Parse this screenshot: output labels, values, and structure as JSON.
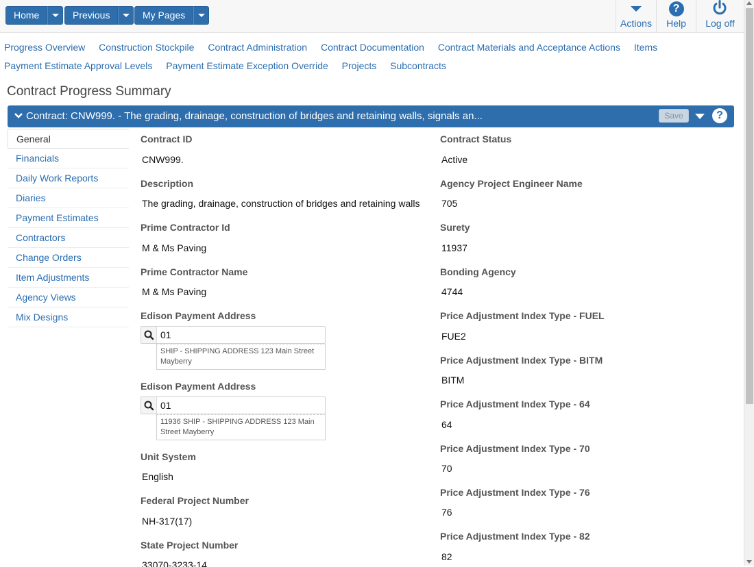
{
  "topbar": {
    "home": "Home",
    "previous": "Previous",
    "my_pages": "My Pages",
    "actions": "Actions",
    "help": "Help",
    "logoff": "Log off"
  },
  "links_row1": [
    "Progress Overview",
    "Construction Stockpile",
    "Contract Administration",
    "Contract Documentation",
    "Contract Materials and Acceptance Actions",
    "Items"
  ],
  "links_row2": [
    "Payment Estimate Approval Levels",
    "Payment Estimate Exception Override",
    "Projects",
    "Subcontracts"
  ],
  "page_title": "Contract Progress Summary",
  "contract_bar": {
    "title": "Contract: CNW999. - The grading, drainage, construction of bridges and retaining walls, signals an...",
    "save": "Save"
  },
  "tabs": [
    "General",
    "Financials",
    "Daily Work Reports",
    "Diaries",
    "Payment Estimates",
    "Contractors",
    "Change Orders",
    "Item Adjustments",
    "Agency Views",
    "Mix Designs"
  ],
  "left_fields": [
    {
      "label": "Contract ID",
      "value": "CNW999."
    },
    {
      "label": "Description",
      "value": "The grading, drainage, construction of bridges and retaining walls, signals"
    },
    {
      "label": "Prime Contractor Id",
      "value": "M & Ms Paving"
    },
    {
      "label": "Prime Contractor Name",
      "value": "M & Ms Paving"
    }
  ],
  "lookups": [
    {
      "label": "Edison Payment Address",
      "value": "01",
      "desc": "SHIP - SHIPPING ADDRESS 123 Main Street Mayberry"
    },
    {
      "label": "Edison Payment Address",
      "value": "01",
      "desc": "11936 SHIP - SHIPPING ADDRESS 123 Main Street Mayberry"
    }
  ],
  "left_fields2": [
    {
      "label": "Unit System",
      "value": "English"
    },
    {
      "label": "Federal Project Number",
      "value": "NH-317(17)"
    },
    {
      "label": "State Project Number",
      "value": "33070-3233-14"
    }
  ],
  "right_fields": [
    {
      "label": "Contract Status",
      "value": "Active"
    },
    {
      "label": "Agency Project Engineer Name",
      "value": "705"
    },
    {
      "label": "Surety",
      "value": "11937"
    },
    {
      "label": "Bonding Agency",
      "value": "4744"
    },
    {
      "label": "Price Adjustment Index Type - FUEL",
      "value": "FUE2"
    },
    {
      "label": "Price Adjustment Index Type - BITM",
      "value": "BITM"
    },
    {
      "label": "Price Adjustment Index Type - 64",
      "value": "64"
    },
    {
      "label": "Price Adjustment Index Type - 70",
      "value": "70"
    },
    {
      "label": "Price Adjustment Index Type - 76",
      "value": "76"
    },
    {
      "label": "Price Adjustment Index Type - 82",
      "value": "82"
    }
  ]
}
